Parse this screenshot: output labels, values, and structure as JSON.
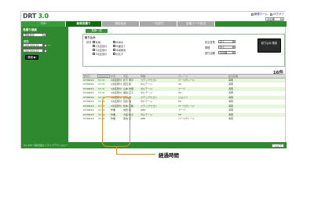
{
  "app": {
    "logo": "DRT",
    "version": "3.0"
  },
  "header": {
    "links": [
      "管理ホーム",
      "ログオフ"
    ],
    "branch": "全店舗"
  },
  "tabs": [
    "TOP",
    "新規見積り",
    "機能検索",
    "一覧受付",
    "各種ユーザ設定"
  ],
  "sidebar": {
    "title": "見積り検索",
    "select_value": "見積状況",
    "date_label": "期間:",
    "date_from": "2007/05/15",
    "date_to": "2007/05/15",
    "search_button": "検索 ▶"
  },
  "main": {
    "section_title": "見積一覧",
    "filter": {
      "title": "絞り込み",
      "status_label": "状況",
      "checkboxes_left": [
        "新規",
        "1次店受付",
        "2次店受付",
        "3次店受付"
      ],
      "checkboxes_right": [
        "作成中",
        "作業完了",
        "中間報告",
        "対応不"
      ],
      "fields": [
        {
          "label": "担当営業",
          "value": "全て"
        },
        {
          "label": "車種",
          "value": "全て"
        },
        {
          "label": "受付店舗",
          "value": "全店舗"
        }
      ],
      "go_button": "絞り込み 検索"
    },
    "count": "16件",
    "table": {
      "headers": [
        "受付日",
        "経過時間",
        "状況",
        "氏名",
        "車種",
        "グレード",
        "担当店舗"
      ],
      "rows": [
        [
          "07/06/12",
          "53:31",
          "2次店受付",
          "杉下 東平",
          "ステップワゴン",
          "ベースグレード",
          "海南"
        ],
        [
          "07/06/12",
          "53:31",
          "1次店受付",
          "田辺 節",
          "ポルテージ",
          "VII",
          "海南"
        ],
        [
          "07/06/12",
          "53:31",
          "1次店受付",
          "山本 志保",
          "ポルテージ",
          "フーバ",
          "海南"
        ],
        [
          "07/06/12",
          "53:31",
          "1次店受付",
          "福島 広子",
          "ポルテージ",
          "VII",
          "海南"
        ],
        [
          "07/06/12",
          "53:31",
          "1次店受付",
          "紙島 健",
          "ステップワゴン",
          "ジョイン",
          "海南"
        ],
        [
          "07/06/12",
          "53:31",
          "1次店受付",
          "高松 静",
          "ポルテージ",
          "VII",
          "海南"
        ],
        [
          "07/06/12",
          "53:07",
          "2次店受付",
          "松本 英梨",
          "ステップワゴン",
          "ベースグレード",
          "海南"
        ],
        [
          "07/06/12",
          "53:22",
          "作業",
          "吉田 昭",
          "Q89",
          "フーバ",
          "海南"
        ],
        [
          "07/06/12",
          "53:42",
          "作業",
          "大庭 敏子",
          "ポルテージ",
          "VII",
          "海南"
        ],
        [
          "07/06/12",
          "53:41",
          "作業",
          "菊池 康",
          "Q89",
          "ベースグレード",
          "海南"
        ]
      ]
    }
  },
  "footer": {
    "copyright": "(C) 2007 株式会社 ドライブテクノロジー",
    "help": "ヘルプ"
  },
  "annotation": "経過時間",
  "colors": {
    "brand_green": "#2f8a2f",
    "highlight_orange": "#e88a2c"
  }
}
